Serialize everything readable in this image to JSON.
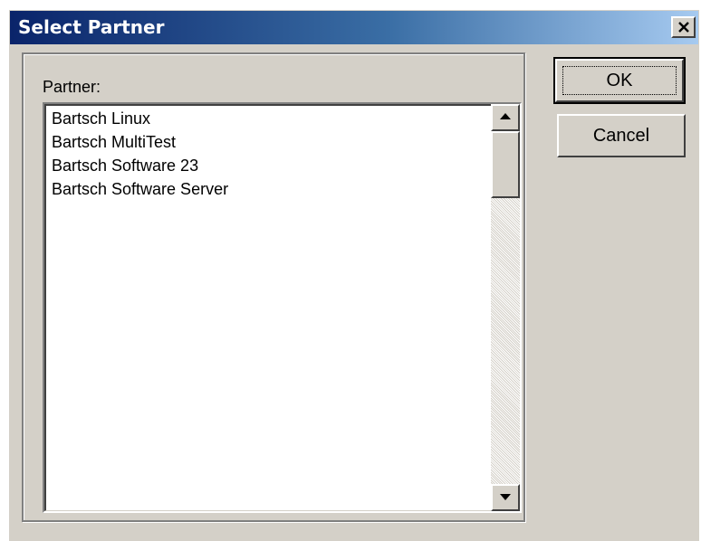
{
  "window": {
    "title": "Select Partner"
  },
  "group": {
    "label": "Partner:"
  },
  "partners": {
    "items": [
      {
        "label": "Bartsch Linux"
      },
      {
        "label": "Bartsch MultiTest"
      },
      {
        "label": "Bartsch Software 23"
      },
      {
        "label": "Bartsch Software Server"
      }
    ]
  },
  "buttons": {
    "ok": "OK",
    "cancel": "Cancel"
  },
  "icons": {
    "close": "close-icon",
    "scroll_up": "arrow-up-icon",
    "scroll_down": "arrow-down-icon"
  },
  "colors": {
    "title_gradient_start": "#0a246a",
    "title_gradient_end": "#a6caf0",
    "dialog_face": "#d4d0c8"
  }
}
